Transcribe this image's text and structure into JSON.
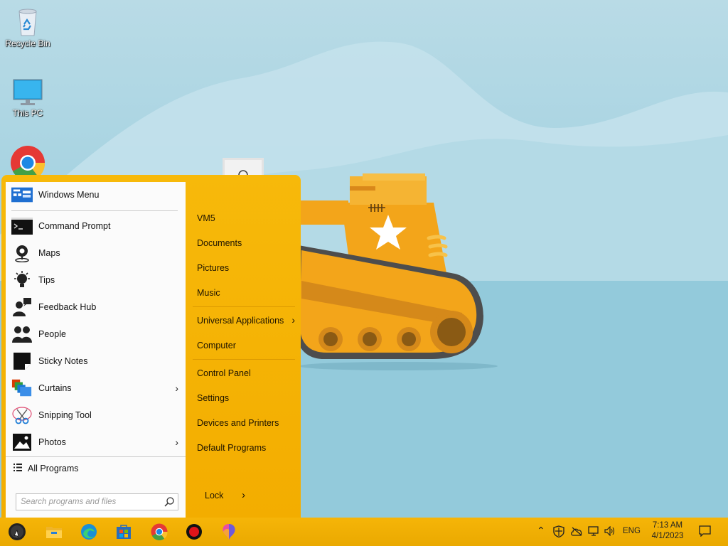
{
  "desktop": {
    "icons": [
      {
        "label": "Recycle Bin",
        "icon": "recycle-bin-icon"
      },
      {
        "label": "This PC",
        "icon": "monitor-icon"
      },
      {
        "label": "",
        "icon": "chrome-icon"
      }
    ]
  },
  "start_menu": {
    "programs": [
      {
        "label": "Windows Menu",
        "icon": "windows-menu-icon"
      },
      {
        "label": "Command Prompt",
        "icon": "command-prompt-icon"
      },
      {
        "label": "Maps",
        "icon": "maps-icon"
      },
      {
        "label": "Tips",
        "icon": "tips-icon"
      },
      {
        "label": "Feedback Hub",
        "icon": "feedback-hub-icon"
      },
      {
        "label": "People",
        "icon": "people-icon"
      },
      {
        "label": "Sticky Notes",
        "icon": "sticky-notes-icon"
      },
      {
        "label": "Curtains",
        "icon": "curtains-icon",
        "has_submenu": true
      },
      {
        "label": "Snipping Tool",
        "icon": "snipping-tool-icon"
      },
      {
        "label": "Photos",
        "icon": "photos-icon",
        "has_submenu": true
      }
    ],
    "all_programs_label": "All Programs",
    "search_placeholder": "Search programs and files",
    "right_items": [
      {
        "label": "VM5"
      },
      {
        "label": "Documents"
      },
      {
        "label": "Pictures"
      },
      {
        "label": "Music"
      },
      {
        "label": "Universal Applications",
        "has_submenu": true
      },
      {
        "label": "Computer"
      },
      {
        "label": "Control Panel"
      },
      {
        "label": "Settings"
      },
      {
        "label": "Devices and Printers"
      },
      {
        "label": "Default Programs"
      }
    ],
    "lock_label": "Lock",
    "lock_arrow": "›",
    "submenu_arrow": "›"
  },
  "taskbar": {
    "apps": [
      "start-button-icon",
      "file-explorer-icon",
      "edge-icon",
      "store-icon",
      "chrome-icon",
      "record-icon",
      "paint-icon"
    ],
    "tray": {
      "language": "ENG",
      "time": "7:13 AM",
      "date": "4/1/2023"
    }
  },
  "colors": {
    "accent": "#f5b000",
    "desktop_sky": "#9dcfdf"
  }
}
